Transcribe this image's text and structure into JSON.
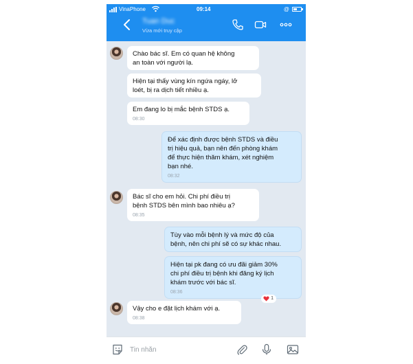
{
  "status_bar": {
    "carrier": "VinaPhone",
    "time": "09:14",
    "indicator": "@"
  },
  "header": {
    "contact_name": "Tuan Duc",
    "status": "Vừa mới truy cập",
    "icons": [
      "back-icon",
      "phone-icon",
      "video-camera-icon",
      "more-icon"
    ]
  },
  "messages": [
    {
      "side": "in",
      "avatar": true,
      "text": "Chào bác sĩ. Em có quan hệ không\nan toàn với người lạ.",
      "time": ""
    },
    {
      "side": "in",
      "avatar": false,
      "text": "Hiện tại thấy vùng kín ngứa ngáy, lở\nloét, bị ra dịch tiết nhiều ạ.",
      "time": ""
    },
    {
      "side": "in",
      "avatar": false,
      "text": "Em đang lo bị mắc bệnh STDS ạ.",
      "time": "08:30"
    },
    {
      "side": "out",
      "text": "Để xác định được bệnh STDS và điều\ntrị hiệu quả, bạn nên đến phòng khám\nđể thực hiện thăm khám, xét nghiệm\nbạn nhé.",
      "time": "08:32"
    },
    {
      "side": "in",
      "avatar": true,
      "text": "Bác sĩ cho em hỏi. Chi phí điều trị\nbệnh STDS bên mình bao nhiêu ạ?",
      "time": "08:35"
    },
    {
      "side": "out",
      "text": "Tùy vào mỗi bệnh lý và mức độ của\nbệnh, nên chi phí sẽ có sự khác nhau.",
      "time": ""
    },
    {
      "side": "out",
      "text": "Hiện tại pk đang có ưu đãi giảm 30%\nchi phí điều trị bệnh khi đăng ký lịch\nkhám trước với bác sĩ.",
      "time": "08:36",
      "reaction": {
        "count": "1",
        "color": "#e8333c"
      }
    },
    {
      "side": "in",
      "avatar": true,
      "text": "Vậy cho e đặt lịch khám với ạ.",
      "time": "08:38"
    }
  ],
  "input_bar": {
    "placeholder": "Tin nhắn",
    "value": "",
    "icons": [
      "sticker-icon",
      "paperclip-icon",
      "microphone-icon",
      "image-icon"
    ]
  },
  "colors": {
    "header": "#1e8ef0",
    "background": "#e2e9f1",
    "incoming_bubble": "#ffffff",
    "outgoing_bubble": "#d4ebfd",
    "reaction_heart": "#e8333c"
  }
}
